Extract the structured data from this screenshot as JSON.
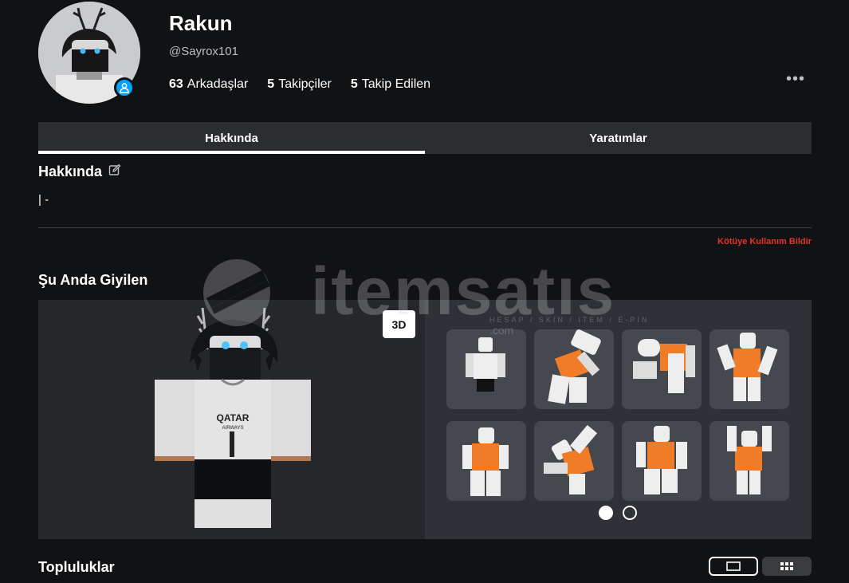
{
  "profile": {
    "name": "Rakun",
    "handle": "@Sayrox101",
    "stats": [
      {
        "count": "63",
        "label": "Arkadaşlar"
      },
      {
        "count": "5",
        "label": "Takipçiler"
      },
      {
        "count": "5",
        "label": "Takip Edilen"
      }
    ],
    "more_icon": "ellipsis-icon",
    "presence_icon": "online-user-icon"
  },
  "tabs": [
    {
      "label": "Hakkında",
      "active": true
    },
    {
      "label": "Yaratımlar",
      "active": false
    }
  ],
  "about": {
    "title": "Hakkında",
    "edit_icon": "edit-icon",
    "text": "| -",
    "report_label": "Kötüye Kullanım Bildir"
  },
  "wearing": {
    "title": "Şu Anda Giyilen",
    "toggle_3d_label": "3D",
    "items": [
      {
        "name": "idle-animation"
      },
      {
        "name": "fall-animation"
      },
      {
        "name": "climb-animation"
      },
      {
        "name": "jump-animation"
      },
      {
        "name": "walk-animation"
      },
      {
        "name": "swim-animation"
      },
      {
        "name": "run-animation"
      },
      {
        "name": "idle-pose-animation"
      }
    ],
    "page_dots": [
      true,
      false
    ]
  },
  "groups": {
    "title": "Topluluklar",
    "view_icons": [
      "list-view-icon",
      "grid-view-icon"
    ]
  },
  "watermark": {
    "text": "itemsatıs",
    "subtext": "HESAP / SKIN / ITEM / E-PIN",
    "domain": ".com"
  },
  "colors": {
    "background": "#111214",
    "accent_blue": "#00a2ff",
    "report_red": "#e5322b",
    "tile": "#45484e"
  }
}
